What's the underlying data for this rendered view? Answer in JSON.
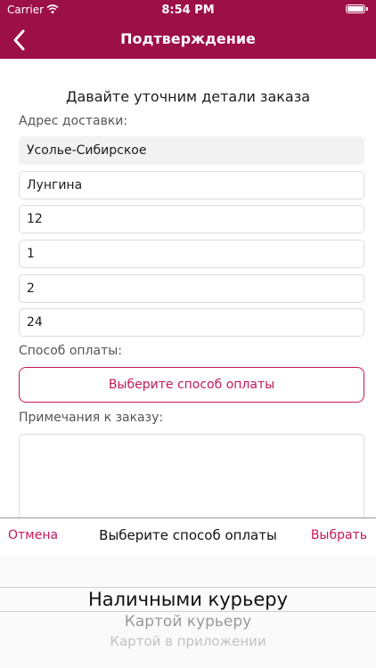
{
  "status": {
    "carrier": "Carrier",
    "time": "8:54 PM"
  },
  "nav": {
    "title": "Подтверждение"
  },
  "form": {
    "subtitle": "Давайте уточним детали заказа",
    "address_label": "Адрес доставки:",
    "address_fields": [
      "Усолье-Сибирское",
      "Лунгина",
      "12",
      "1",
      "2",
      "24"
    ],
    "payment_label": "Способ оплаты:",
    "payment_button": "Выберите способ оплаты",
    "notes_label": "Примечания к заказу:",
    "notes_value": ""
  },
  "picker": {
    "cancel": "Отмена",
    "title": "Выберите способ оплаты",
    "select": "Выбрать",
    "options": [
      "Наличными курьеру",
      "Картой курьеру",
      "Картой в приложении"
    ]
  },
  "colors": {
    "brand": "#9c0f47",
    "accent": "#c2185b"
  }
}
